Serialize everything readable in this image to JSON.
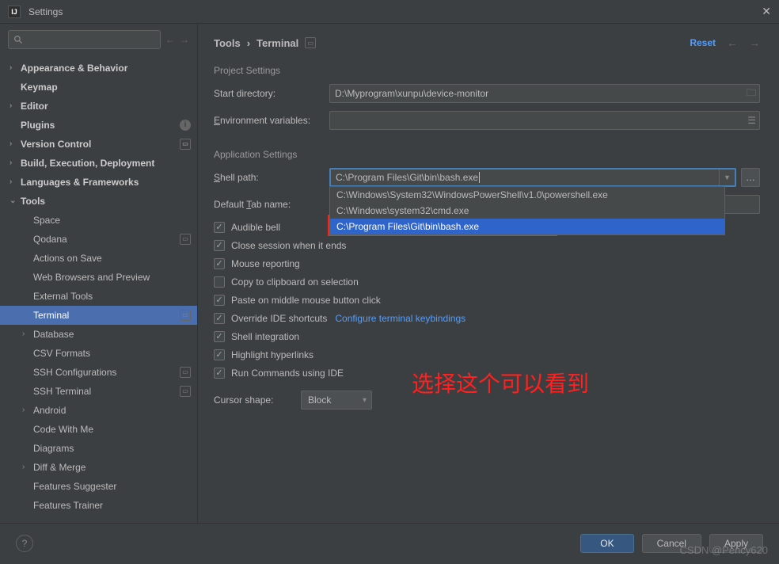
{
  "window": {
    "title": "Settings"
  },
  "breadcrumb": {
    "root": "Tools",
    "sep": "›",
    "leaf": "Terminal"
  },
  "reset_label": "Reset",
  "sidebar": {
    "items": [
      {
        "label": "Appearance & Behavior",
        "chev": "›",
        "bold": true
      },
      {
        "label": "Keymap",
        "bold": true
      },
      {
        "label": "Editor",
        "chev": "›",
        "bold": true
      },
      {
        "label": "Plugins",
        "bold": true,
        "info": true
      },
      {
        "label": "Version Control",
        "chev": "›",
        "bold": true,
        "badge": true
      },
      {
        "label": "Build, Execution, Deployment",
        "chev": "›",
        "bold": true
      },
      {
        "label": "Languages & Frameworks",
        "chev": "›",
        "bold": true
      },
      {
        "label": "Tools",
        "chev": "⌄",
        "bold": true
      },
      {
        "label": "Space",
        "level": 1
      },
      {
        "label": "Qodana",
        "level": 1,
        "badge": true
      },
      {
        "label": "Actions on Save",
        "level": 1
      },
      {
        "label": "Web Browsers and Preview",
        "level": 1
      },
      {
        "label": "External Tools",
        "level": 1
      },
      {
        "label": "Terminal",
        "level": 1,
        "badge": true,
        "selected": true
      },
      {
        "label": "Database",
        "level": 1,
        "chev": "›"
      },
      {
        "label": "CSV Formats",
        "level": 1
      },
      {
        "label": "SSH Configurations",
        "level": 1,
        "badge": true
      },
      {
        "label": "SSH Terminal",
        "level": 1,
        "badge": true
      },
      {
        "label": "Android",
        "level": 1,
        "chev": "›"
      },
      {
        "label": "Code With Me",
        "level": 1
      },
      {
        "label": "Diagrams",
        "level": 1
      },
      {
        "label": "Diff & Merge",
        "level": 1,
        "chev": "›"
      },
      {
        "label": "Features Suggester",
        "level": 1
      },
      {
        "label": "Features Trainer",
        "level": 1
      }
    ]
  },
  "sections": {
    "project": "Project Settings",
    "application": "Application Settings"
  },
  "fields": {
    "start_dir_label": "Start directory:",
    "start_dir_value": "D:\\Myprogram\\xunpu\\device-monitor",
    "env_label": "Environment variables:",
    "env_label_u": "E",
    "shell_label": "Shell path:",
    "shell_label_u": "S",
    "shell_value": "C:\\Program Files\\Git\\bin\\bash.exe",
    "tab_label": "Default Tab name:",
    "tab_label_u": "T",
    "cursor_label": "Cursor shape:",
    "cursor_value": "Block"
  },
  "dropdown": {
    "opt0": "C:\\Windows\\System32\\WindowsPowerShell\\v1.0\\powershell.exe",
    "opt1": "C:\\Windows\\system32\\cmd.exe",
    "opt2": "C:\\Program Files\\Git\\bin\\bash.exe"
  },
  "checkboxes": {
    "audible": "Audible bell",
    "close": "Close session when it ends",
    "mouse": "Mouse reporting",
    "copy": "Copy to clipboard on selection",
    "paste": "Paste on middle mouse button click",
    "override": "Override IDE shortcuts",
    "override_link": "Configure terminal keybindings",
    "shell_int": "Shell integration",
    "hyper": "Highlight hyperlinks",
    "run_ide": "Run Commands using IDE"
  },
  "annotation": "选择这个可以看到",
  "footer": {
    "ok": "OK",
    "cancel": "Cancel",
    "apply": "Apply"
  },
  "watermark": "CSDN @Pency620"
}
